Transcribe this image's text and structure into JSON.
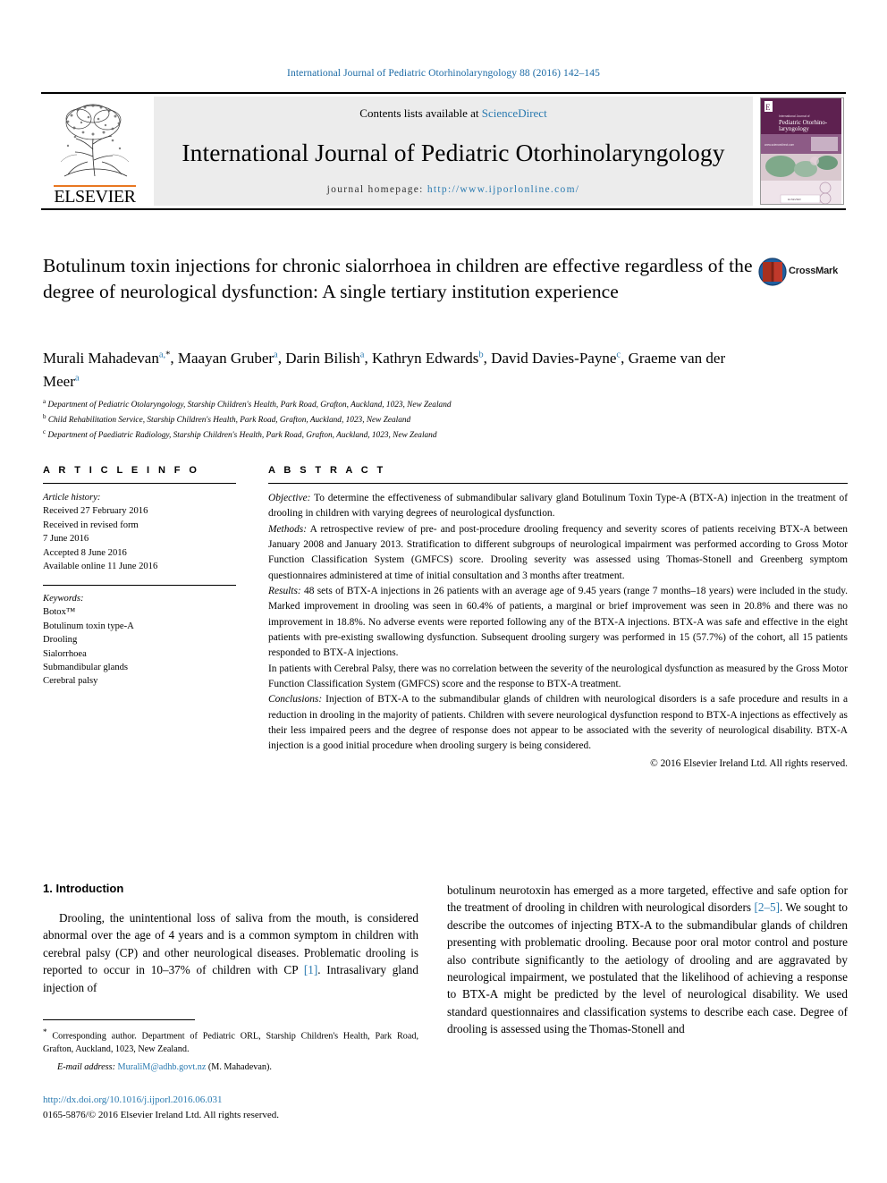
{
  "running_head": "International Journal of Pediatric Otorhinolaryngology 88 (2016) 142–145",
  "masthead": {
    "publisher": "ELSEVIER",
    "contents_prefix": "Contents lists available at ",
    "contents_link": "ScienceDirect",
    "journal_title": "International Journal of Pediatric Otorhinolaryngology",
    "homepage_prefix": "journal homepage: ",
    "homepage_url": "http://www.ijporlonline.com/",
    "cover_journal_label": "International Journal of",
    "cover_journal_name": "Pediatric Otorhinolaryngology"
  },
  "article": {
    "title": "Botulinum toxin injections for chronic sialorrhoea in children are effective regardless of the degree of neurological dysfunction: A single tertiary institution experience",
    "crossmark_label": "CrossMark",
    "authors": [
      {
        "name": "Murali Mahadevan",
        "marks": "a,",
        "star": true
      },
      {
        "name": "Maayan Gruber",
        "marks": "a",
        "star": false
      },
      {
        "name": "Darin Bilish",
        "marks": "a",
        "star": false
      },
      {
        "name": "Kathryn Edwards",
        "marks": "b",
        "star": false
      },
      {
        "name": "David Davies-Payne",
        "marks": "c",
        "star": false
      },
      {
        "name": "Graeme van der Meer",
        "marks": "a",
        "star": false
      }
    ],
    "affiliations": [
      {
        "mark": "a",
        "text": "Department of Pediatric Otolaryngology, Starship Children's Health, Park Road, Grafton, Auckland, 1023, New Zealand"
      },
      {
        "mark": "b",
        "text": "Child Rehabilitation Service, Starship Children's Health, Park Road, Grafton, Auckland, 1023, New Zealand"
      },
      {
        "mark": "c",
        "text": "Department of Paediatric Radiology, Starship Children's Health, Park Road, Grafton, Auckland, 1023, New Zealand"
      }
    ]
  },
  "article_info": {
    "heading": "A R T I C L E  I N F O",
    "history_label": "Article history:",
    "history": [
      "Received 27 February 2016",
      "Received in revised form",
      "7 June 2016",
      "Accepted 8 June 2016",
      "Available online 11 June 2016"
    ],
    "keywords_label": "Keywords:",
    "keywords": [
      "Botox™",
      "Botulinum toxin type-A",
      "Drooling",
      "Sialorrhoea",
      "Submandibular glands",
      "Cerebral palsy"
    ]
  },
  "abstract": {
    "heading": "A B S T R A C T",
    "objective_label": "Objective:",
    "objective_text": " To determine the effectiveness of submandibular salivary gland Botulinum Toxin Type-A (BTX-A) injection in the treatment of drooling in children with varying degrees of neurological dysfunction.",
    "methods_label": "Methods:",
    "methods_text": " A retrospective review of pre- and post-procedure drooling frequency and severity scores of patients receiving BTX-A between January 2008 and January 2013. Stratification to different subgroups of neurological impairment was performed according to Gross Motor Function Classification System (GMFCS) score. Drooling severity was assessed using Thomas-Stonell and Greenberg symptom questionnaires administered at time of initial consultation and 3 months after treatment.",
    "results_label": "Results:",
    "results_text": " 48 sets of BTX-A injections in 26 patients with an average age of 9.45 years (range 7 months–18 years) were included in the study. Marked improvement in drooling was seen in 60.4% of patients, a marginal or brief improvement was seen in 20.8% and there was no improvement in 18.8%. No adverse events were reported following any of the BTX-A injections. BTX-A was safe and effective in the eight patients with pre-existing swallowing dysfunction. Subsequent drooling surgery was performed in 15 (57.7%) of the cohort, all 15 patients responded to BTX-A injections.",
    "results_text2": "In patients with Cerebral Palsy, there was no correlation between the severity of the neurological dysfunction as measured by the Gross Motor Function Classification System (GMFCS) score and the response to BTX-A treatment.",
    "conclusions_label": "Conclusions:",
    "conclusions_text": " Injection of BTX-A to the submandibular glands of children with neurological disorders is a safe procedure and results in a reduction in drooling in the majority of patients. Children with severe neurological dysfunction respond to BTX-A injections as effectively as their less impaired peers and the degree of response does not appear to be associated with the severity of neurological disability. BTX-A injection is a good initial procedure when drooling surgery is being considered.",
    "copyright": "© 2016 Elsevier Ireland Ltd. All rights reserved."
  },
  "introduction": {
    "heading": "1.  Introduction",
    "left_p1_a": "Drooling, the unintentional loss of saliva from the mouth, is considered abnormal over the age of 4 years and is a common symptom in children with cerebral palsy (CP) and other neurological diseases. Problematic drooling is reported to occur in 10–37% of children with CP ",
    "left_ref1": "[1]",
    "left_p1_b": ". Intrasalivary gland injection of",
    "right_p1_a": "botulinum neurotoxin has emerged as a more targeted, effective and safe option for the treatment of drooling in children with neurological disorders ",
    "right_ref1": "[2–5]",
    "right_p1_b": ". We sought to describe the outcomes of injecting BTX-A to the submandibular glands of children presenting with problematic drooling. Because poor oral motor control and posture also contribute significantly to the aetiology of drooling and are aggravated by neurological impairment, we postulated that the likelihood of achieving a response to BTX-A might be predicted by the level of neurological disability. We used standard questionnaires and classification systems to describe each case. Degree of drooling is assessed using the Thomas-Stonell and"
  },
  "footnotes": {
    "corresponding": " Corresponding author. Department of Pediatric ORL, Starship Children's Health, Park Road, Grafton, Auckland, 1023, New Zealand.",
    "email_label": "E-mail address:",
    "email": "MuraliM@adhb.govt.nz",
    "email_suffix": " (M. Mahadevan).",
    "doi": "http://dx.doi.org/10.1016/j.ijporl.2016.06.031",
    "issn": "0165-5876/© 2016 Elsevier Ireland Ltd. All rights reserved."
  },
  "colors": {
    "link": "#2a7ab0",
    "elsevier_orange": "#e87722",
    "runhead": "#1b6aa5"
  }
}
